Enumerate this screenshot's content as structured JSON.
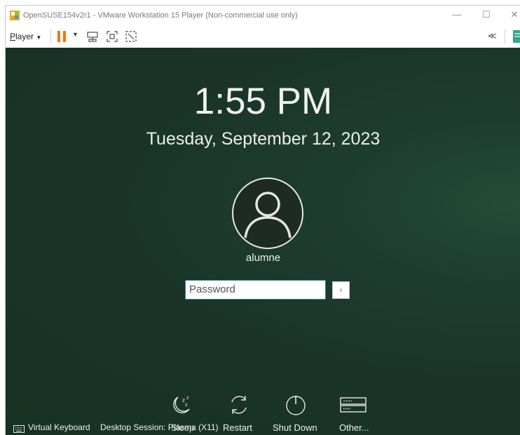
{
  "window": {
    "title": "OpenSUSE154v2r1 - VMware Workstation 15 Player (Non-commercial use only)",
    "minimize": "—",
    "maximize": "☐",
    "close": "✕"
  },
  "toolbar": {
    "player_menu": "Player",
    "player_menu_accel": "P",
    "player_menu_rest": "layer",
    "collapse": "≪"
  },
  "login": {
    "time": "1:55 PM",
    "date": "Tuesday, September 12, 2023",
    "username": "alumne",
    "password_placeholder": "Password",
    "submit": "›"
  },
  "bottom_bar": {
    "virtual_keyboard": "Virtual Keyboard",
    "desktop_session": "Desktop Session: Plasma (X11)",
    "sleep": "Sleep",
    "restart": "Restart",
    "shut_down": "Shut Down",
    "other": "Other..."
  },
  "colors": {
    "accent_pause": "#f07800",
    "screen_bg": "#1a3528",
    "input_border": "#2f8a7e"
  }
}
